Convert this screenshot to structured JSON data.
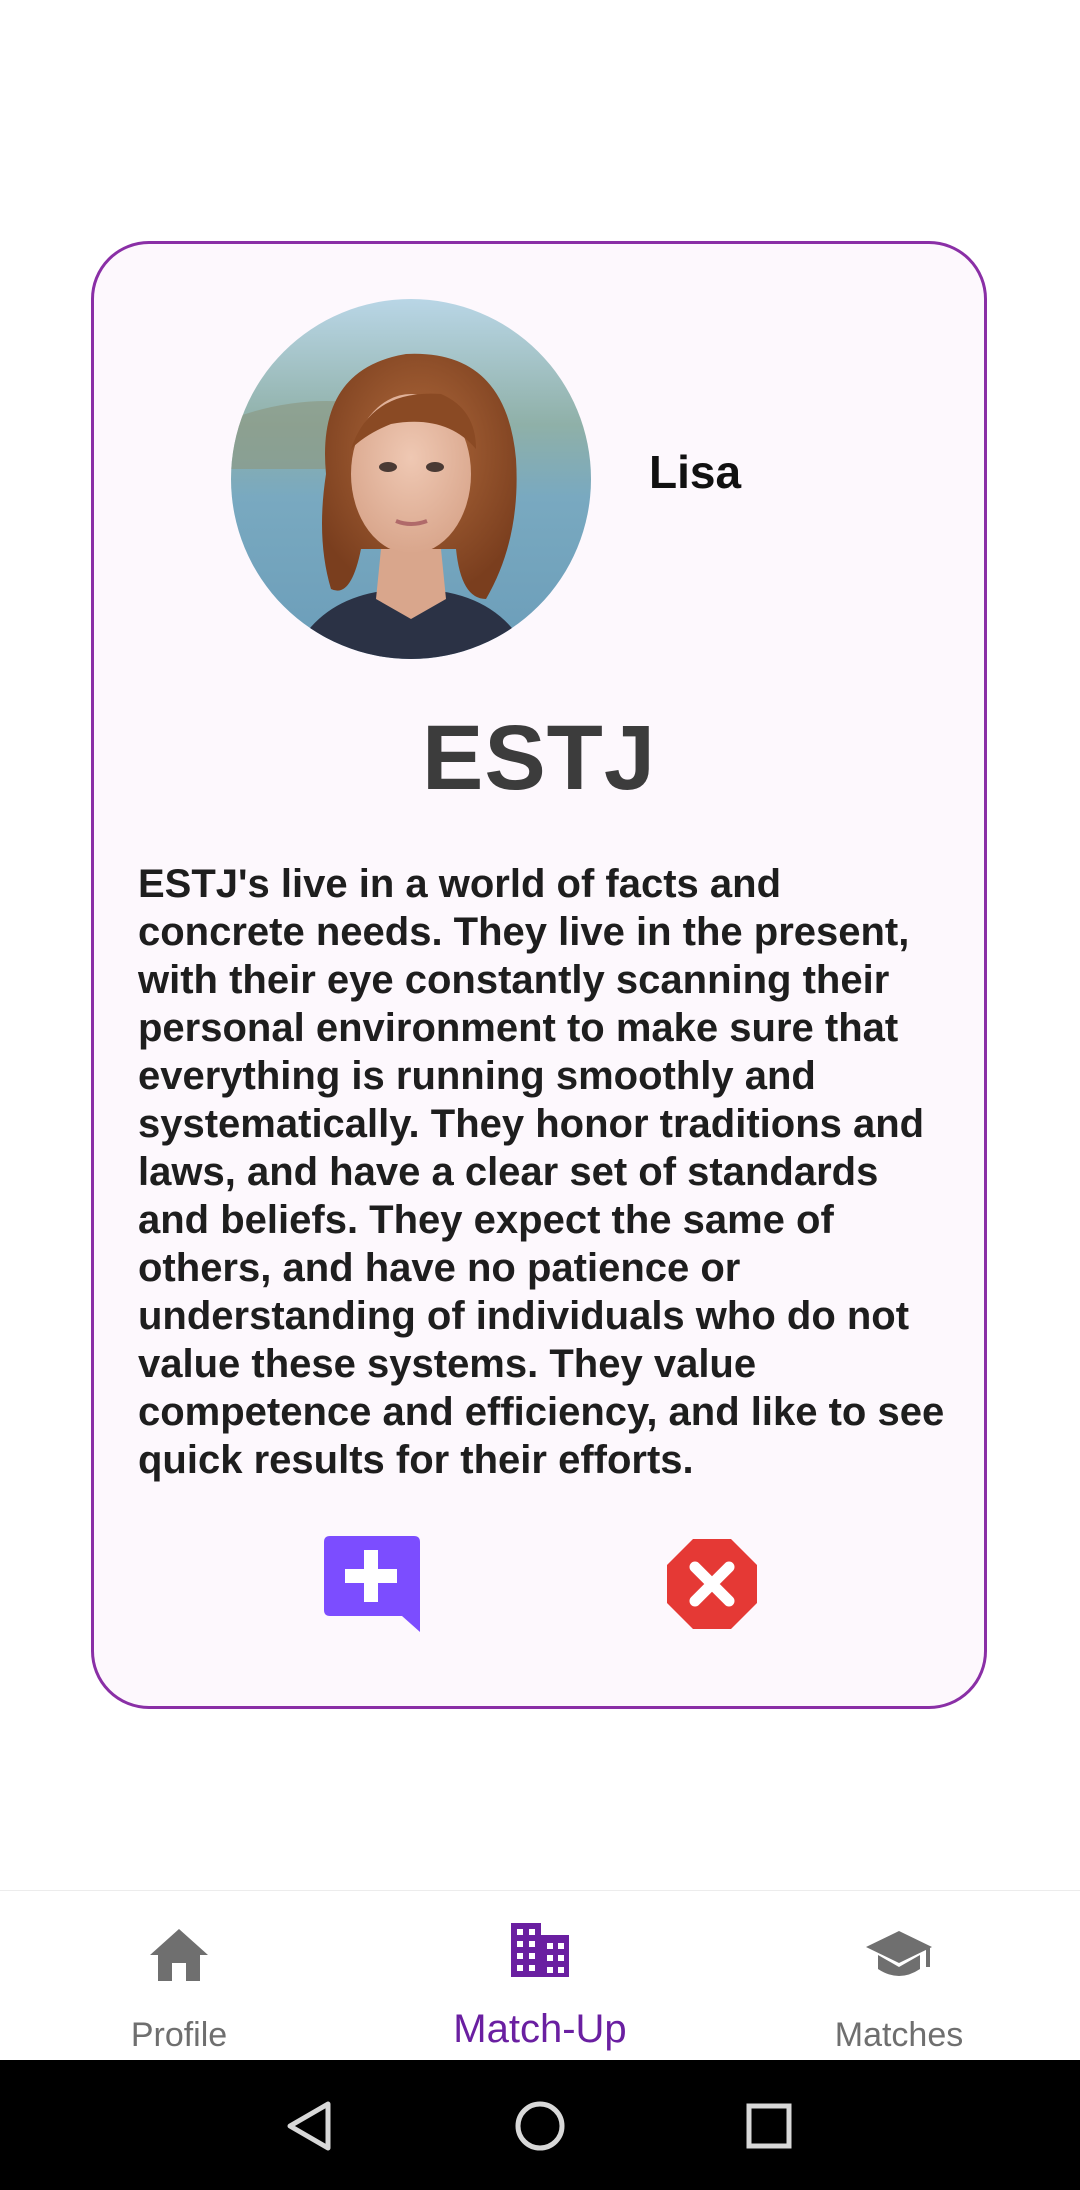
{
  "profile": {
    "name": "Lisa",
    "personality_type": "ESTJ",
    "description": "ESTJ's live in a world of facts and concrete needs. They live in the present, with their eye constantly scanning their personal environment to make sure that everything is running smoothly and systematically. They honor traditions and laws, and have a clear set of standards and beliefs. They expect the same of others, and have no patience or understanding of individuals who do not value these systems. They value competence and efficiency, and like to see quick results for their efforts."
  },
  "actions": {
    "add_icon": "add-comment-icon",
    "dismiss_icon": "close-circle-icon"
  },
  "bottom_nav": {
    "items": [
      {
        "label": "Profile",
        "icon": "home-icon",
        "active": false
      },
      {
        "label": "Match-Up",
        "icon": "building-icon",
        "active": true
      },
      {
        "label": "Matches",
        "icon": "graduation-cap-icon",
        "active": false
      }
    ]
  },
  "colors": {
    "card_border": "#8a2fa6",
    "card_background": "#fdf8fd",
    "add_button": "#7c4dff",
    "dismiss_button": "#e53935",
    "nav_active": "#6a1fa1",
    "nav_inactive": "#6f6f6f"
  },
  "system_nav": {
    "icons": [
      "back-triangle-icon",
      "home-circle-icon",
      "recents-square-icon"
    ]
  }
}
